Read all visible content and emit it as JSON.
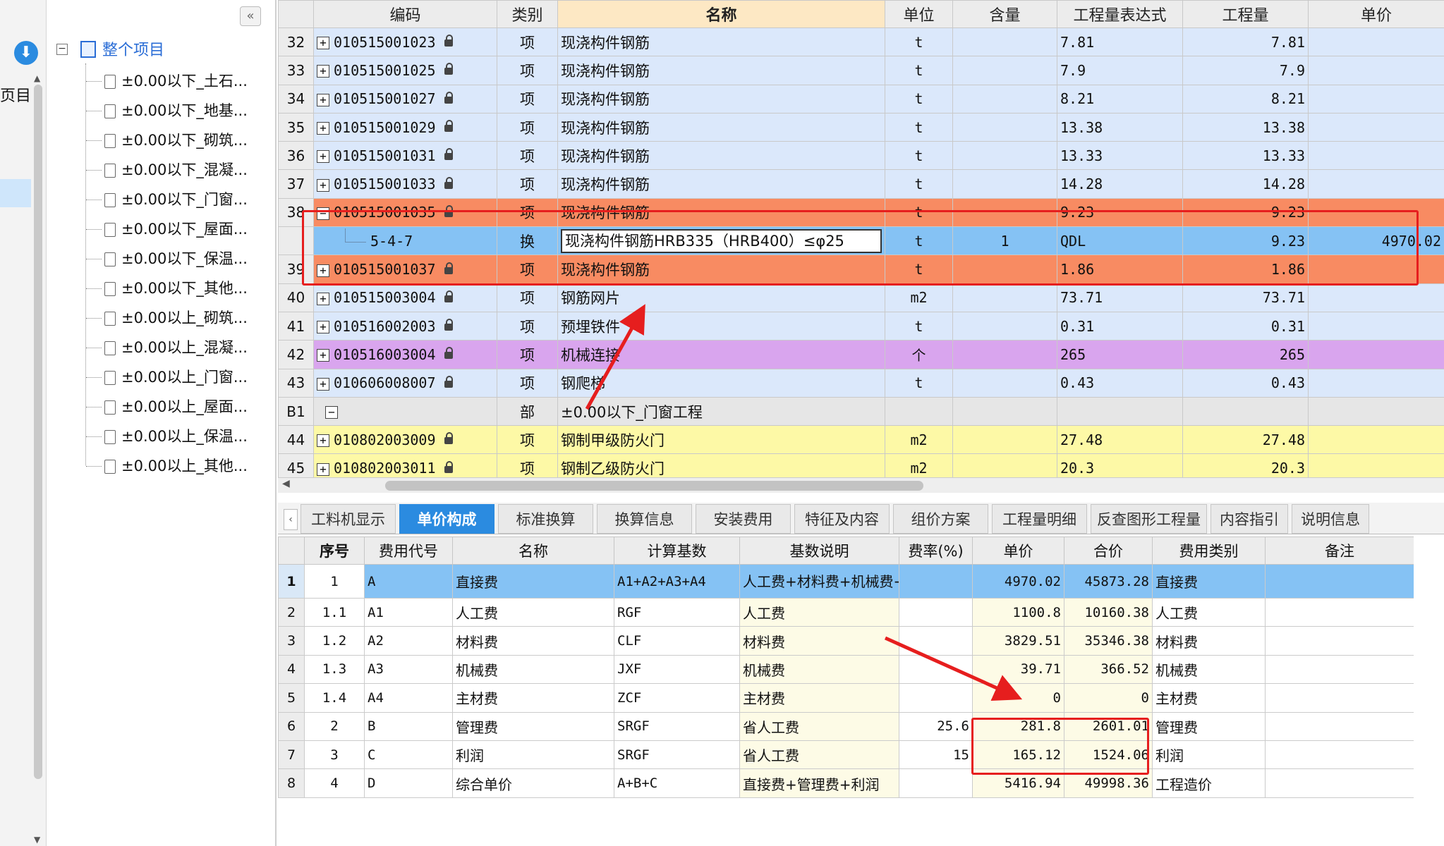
{
  "left_strip": {
    "label": "页目"
  },
  "tree": {
    "root": "整个项目",
    "items": [
      "±0.00以下_土石...",
      "±0.00以下_地基...",
      "±0.00以下_砌筑...",
      "±0.00以下_混凝...",
      "±0.00以下_门窗...",
      "±0.00以下_屋面...",
      "±0.00以下_保温...",
      "±0.00以下_其他...",
      "±0.00以上_砌筑...",
      "±0.00以上_混凝...",
      "±0.00以上_门窗...",
      "±0.00以上_屋面...",
      "±0.00以上_保温...",
      "±0.00以上_其他..."
    ]
  },
  "grid": {
    "headers": {
      "code": "编码",
      "type": "类别",
      "name": "名称",
      "unit": "单位",
      "content": "含量",
      "expr": "工程量表达式",
      "qty": "工程量",
      "price": "单价"
    },
    "rows": [
      {
        "no": "32",
        "toggle": "+",
        "code": "010515001023",
        "type": "项",
        "name": "现浇构件钢筋",
        "unit": "t",
        "content": "",
        "expr": "7.81",
        "qty": "7.81",
        "price": ""
      },
      {
        "no": "33",
        "toggle": "+",
        "code": "010515001025",
        "type": "项",
        "name": "现浇构件钢筋",
        "unit": "t",
        "content": "",
        "expr": "7.9",
        "qty": "7.9",
        "price": ""
      },
      {
        "no": "34",
        "toggle": "+",
        "code": "010515001027",
        "type": "项",
        "name": "现浇构件钢筋",
        "unit": "t",
        "content": "",
        "expr": "8.21",
        "qty": "8.21",
        "price": ""
      },
      {
        "no": "35",
        "toggle": "+",
        "code": "010515001029",
        "type": "项",
        "name": "现浇构件钢筋",
        "unit": "t",
        "content": "",
        "expr": "13.38",
        "qty": "13.38",
        "price": ""
      },
      {
        "no": "36",
        "toggle": "+",
        "code": "010515001031",
        "type": "项",
        "name": "现浇构件钢筋",
        "unit": "t",
        "content": "",
        "expr": "13.33",
        "qty": "13.33",
        "price": ""
      },
      {
        "no": "37",
        "toggle": "+",
        "code": "010515001033",
        "type": "项",
        "name": "现浇构件钢筋",
        "unit": "t",
        "content": "",
        "expr": "14.28",
        "qty": "14.28",
        "price": ""
      },
      {
        "no": "38",
        "toggle": "−",
        "code": "010515001035",
        "type": "项",
        "name": "现浇构件钢筋",
        "unit": "t",
        "content": "",
        "expr": "9.23",
        "qty": "9.23",
        "price": ""
      },
      {
        "no": "",
        "toggle": "",
        "code": "5-4-7",
        "type": "换",
        "name": "现浇构件钢筋HRB335（HRB400）≤φ25",
        "unit": "t",
        "content": "1",
        "expr": "QDL",
        "qty": "9.23",
        "price": "4970.02"
      },
      {
        "no": "39",
        "toggle": "+",
        "code": "010515001037",
        "type": "项",
        "name": "现浇构件钢筋",
        "unit": "t",
        "content": "",
        "expr": "1.86",
        "qty": "1.86",
        "price": ""
      },
      {
        "no": "40",
        "toggle": "+",
        "code": "010515003004",
        "type": "项",
        "name": "钢筋网片",
        "unit": "m2",
        "content": "",
        "expr": "73.71",
        "qty": "73.71",
        "price": ""
      },
      {
        "no": "41",
        "toggle": "+",
        "code": "010516002003",
        "type": "项",
        "name": "预埋铁件",
        "unit": "t",
        "content": "",
        "expr": "0.31",
        "qty": "0.31",
        "price": ""
      },
      {
        "no": "42",
        "toggle": "+",
        "code": "010516003004",
        "type": "项",
        "name": "机械连接",
        "unit": "个",
        "content": "",
        "expr": "265",
        "qty": "265",
        "price": ""
      },
      {
        "no": "43",
        "toggle": "+",
        "code": "010606008007",
        "type": "项",
        "name": "钢爬梯",
        "unit": "t",
        "content": "",
        "expr": "0.43",
        "qty": "0.43",
        "price": ""
      },
      {
        "no": "B1",
        "toggle": "−",
        "code": "",
        "type": "部",
        "name": "±0.00以下_门窗工程",
        "unit": "",
        "content": "",
        "expr": "",
        "qty": "",
        "price": ""
      },
      {
        "no": "44",
        "toggle": "+",
        "code": "010802003009",
        "type": "项",
        "name": "钢制甲级防火门",
        "unit": "m2",
        "content": "",
        "expr": "27.48",
        "qty": "27.48",
        "price": ""
      },
      {
        "no": "45",
        "toggle": "+",
        "code": "010802003011",
        "type": "项",
        "name": "钢制乙级防火门",
        "unit": "m2",
        "content": "",
        "expr": "20.3",
        "qty": "20.3",
        "price": ""
      }
    ]
  },
  "tabs": [
    "工料机显示",
    "单价构成",
    "标准换算",
    "换算信息",
    "安装费用",
    "特征及内容",
    "组价方案",
    "工程量明细",
    "反查图形工程量",
    "内容指引",
    "说明信息"
  ],
  "active_tab": "单价构成",
  "breakdown": {
    "headers": {
      "seq": "序号",
      "code": "费用代号",
      "name": "名称",
      "base": "计算基数",
      "desc": "基数说明",
      "rate": "费率(%)",
      "unit_price": "单价",
      "total": "合价",
      "category": "费用类别",
      "note": "备注"
    },
    "rows": [
      {
        "row": "1",
        "seq": "1",
        "code": "A",
        "name": "直接费",
        "base": "A1+A2+A3+A4",
        "desc": "人工费+材料费+机械费+主材费",
        "rate": "",
        "unit_price": "4970.02",
        "total": "45873.28",
        "category": "直接费",
        "note": ""
      },
      {
        "row": "2",
        "seq": "1.1",
        "code": "A1",
        "name": "人工费",
        "base": "RGF",
        "desc": "人工费",
        "rate": "",
        "unit_price": "1100.8",
        "total": "10160.38",
        "category": "人工费",
        "note": ""
      },
      {
        "row": "3",
        "seq": "1.2",
        "code": "A2",
        "name": "材料费",
        "base": "CLF",
        "desc": "材料费",
        "rate": "",
        "unit_price": "3829.51",
        "total": "35346.38",
        "category": "材料费",
        "note": ""
      },
      {
        "row": "4",
        "seq": "1.3",
        "code": "A3",
        "name": "机械费",
        "base": "JXF",
        "desc": "机械费",
        "rate": "",
        "unit_price": "39.71",
        "total": "366.52",
        "category": "机械费",
        "note": ""
      },
      {
        "row": "5",
        "seq": "1.4",
        "code": "A4",
        "name": "主材费",
        "base": "ZCF",
        "desc": "主材费",
        "rate": "",
        "unit_price": "0",
        "total": "0",
        "category": "主材费",
        "note": ""
      },
      {
        "row": "6",
        "seq": "2",
        "code": "B",
        "name": "管理费",
        "base": "SRGF",
        "desc": "省人工费",
        "rate": "25.6",
        "unit_price": "281.8",
        "total": "2601.01",
        "category": "管理费",
        "note": ""
      },
      {
        "row": "7",
        "seq": "3",
        "code": "C",
        "name": "利润",
        "base": "SRGF",
        "desc": "省人工费",
        "rate": "15",
        "unit_price": "165.12",
        "total": "1524.06",
        "category": "利润",
        "note": ""
      },
      {
        "row": "8",
        "seq": "4",
        "code": "D",
        "name": "综合单价",
        "base": "A+B+C",
        "desc": "直接费+管理费+利润",
        "rate": "",
        "unit_price": "5416.94",
        "total": "49998.36",
        "category": "工程造价",
        "note": ""
      }
    ]
  },
  "colors": {
    "accent": "#2b8be0",
    "annotation": "#e61e1e",
    "row_orange": "#f88b62",
    "row_blue": "#dbe8fb",
    "row_selected": "#85c2f4",
    "row_purple": "#d9a5ee",
    "row_yellow": "#fdf9a6"
  }
}
